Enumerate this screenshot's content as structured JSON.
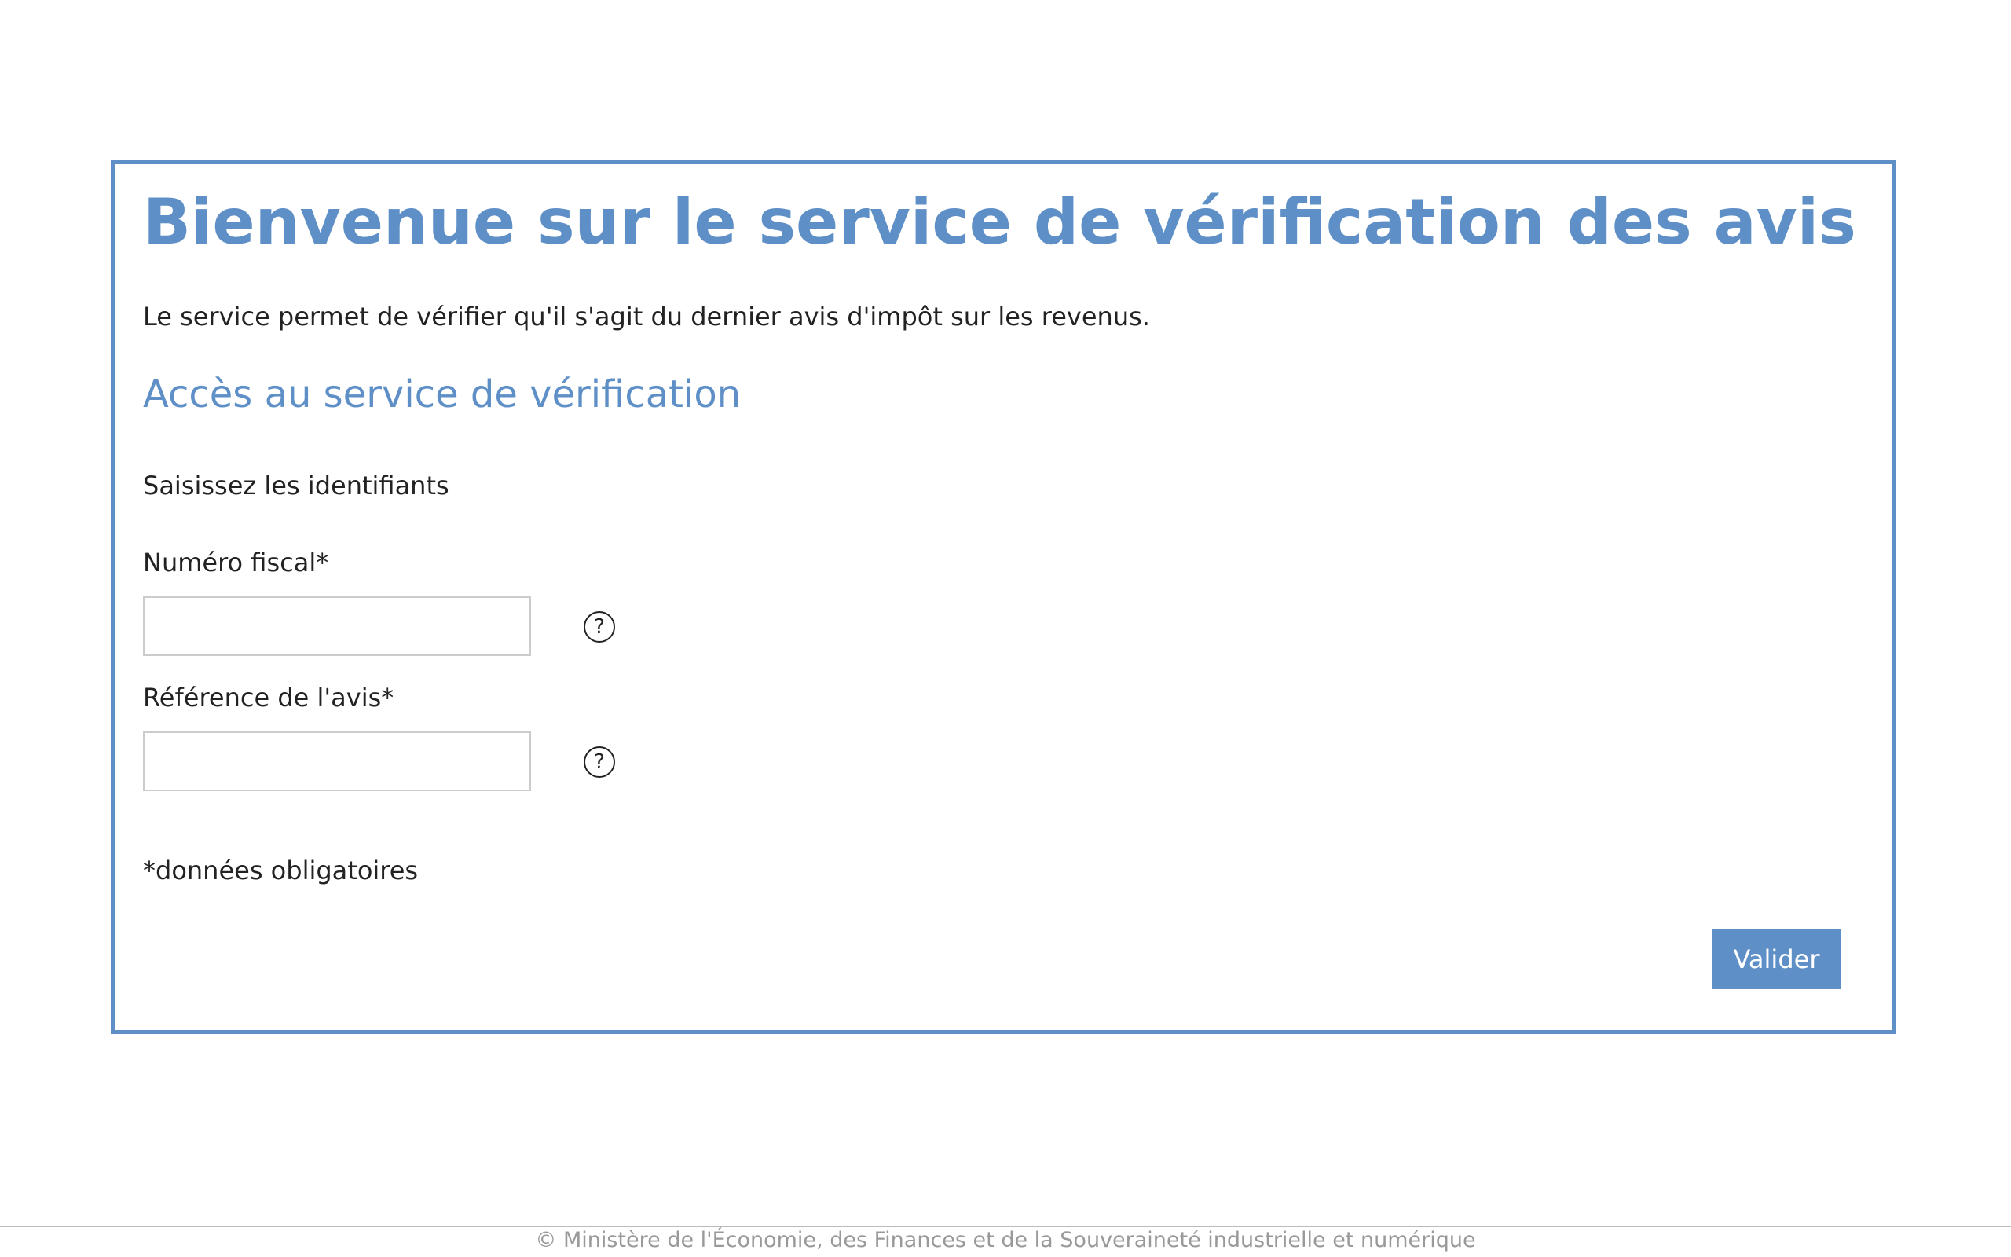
{
  "panel": {
    "title": "Bienvenue sur le service de vérification des avis",
    "intro": "Le service permet de vérifier qu'il s'agit du dernier avis d'impôt sur les revenus.",
    "section_title": "Accès au service de vérification",
    "instruction": "Saisissez les identifiants"
  },
  "form": {
    "fiscal_number": {
      "label": "Numéro fiscal*",
      "value": "",
      "help_icon": "question-mark-icon",
      "help_glyph": "?"
    },
    "notice_reference": {
      "label": "Référence de l'avis*",
      "value": "",
      "help_icon": "question-mark-icon",
      "help_glyph": "?"
    },
    "mandatory_note": "*données obligatoires",
    "submit_label": "Valider"
  },
  "footer": {
    "copyright": "© Ministère de l'Économie, des Finances et de la Souveraineté industrielle et numérique"
  },
  "colors": {
    "accent": "#5e8fc6",
    "text": "#222222",
    "input_border": "#cccccc",
    "footer_text": "#999999"
  }
}
